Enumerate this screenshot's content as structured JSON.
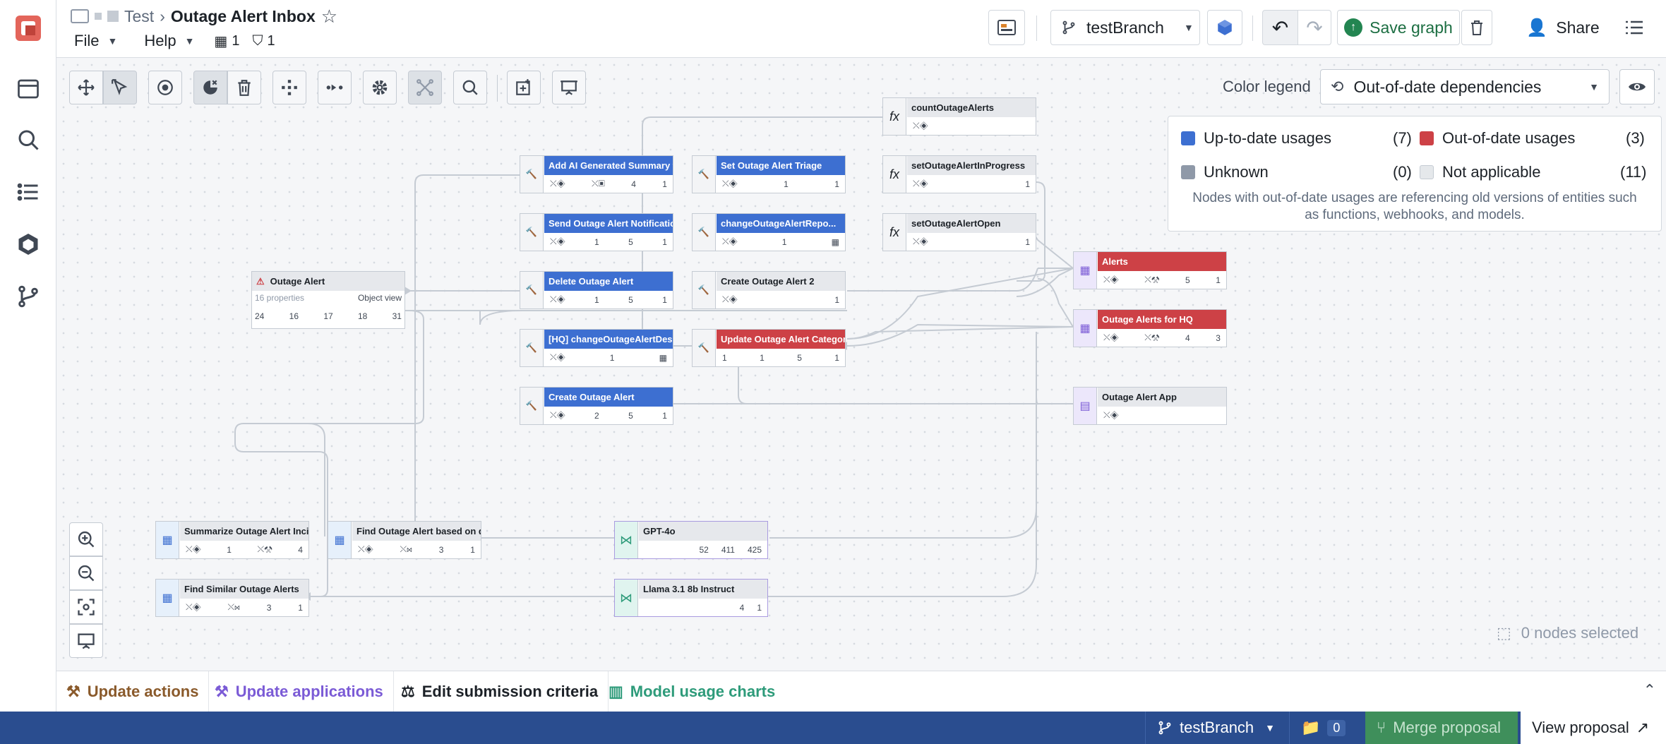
{
  "header": {
    "breadcrumb_parent": "Test",
    "title": "Outage Alert Inbox",
    "menu_file": "File",
    "menu_help": "Help",
    "ontology_count": "1",
    "shield_count": "1",
    "branch": "testBranch",
    "save_label": "Save graph",
    "share_label": "Share"
  },
  "legend": {
    "label": "Color legend",
    "selected": "Out-of-date dependencies",
    "items": [
      {
        "label": "Up-to-date usages",
        "count": "(7)",
        "color": "#3d6fd1"
      },
      {
        "label": "Out-of-date usages",
        "count": "(3)",
        "color": "#cd4146"
      },
      {
        "label": "Unknown",
        "count": "(0)",
        "color": "#8f99a8"
      },
      {
        "label": "Not applicable",
        "count": "(11)",
        "color": "#e5e8eb"
      }
    ],
    "note": "Nodes with out-of-date usages are referencing old versions of entities such as functions, webhooks, and models."
  },
  "nodes": {
    "count_outage_alerts": {
      "title": "countOutageAlerts"
    },
    "add_ai_summary": {
      "title": "Add AI Generated Summary to...",
      "c1": "4",
      "c2": "1"
    },
    "set_triage": {
      "title": "Set Outage Alert Triage",
      "c1": "1",
      "c2": "1"
    },
    "set_in_progress": {
      "title": "setOutageAlertInProgress",
      "c1": "1"
    },
    "send_notification": {
      "title": "Send Outage Alert Notificatio...",
      "c1": "1",
      "c2": "5",
      "c3": "1"
    },
    "change_report": {
      "title": "changeOutageAlertRepo...",
      "c1": "1"
    },
    "set_open": {
      "title": "setOutageAlertOpen",
      "c1": "1"
    },
    "outage_alert": {
      "title": "Outage Alert",
      "props": "16 properties",
      "view": "Object view",
      "c1": "24",
      "c2": "16",
      "c3": "17",
      "c4": "18",
      "c5": "31"
    },
    "delete_alert": {
      "title": "Delete Outage Alert",
      "c1": "1",
      "c2": "5",
      "c3": "1"
    },
    "create_alert_2": {
      "title": "Create Outage Alert 2",
      "c1": "1"
    },
    "alerts": {
      "title": "Alerts",
      "c1": "5",
      "c2": "1"
    },
    "hq_change_desc": {
      "title": "[HQ] changeOutageAlertDescr...",
      "c1": "1"
    },
    "update_category": {
      "title": "Update Outage Alert Category",
      "c1": "1",
      "c2": "1",
      "c3": "5",
      "c4": "1"
    },
    "alerts_hq": {
      "title": "Outage Alerts for HQ",
      "c1": "4",
      "c2": "3"
    },
    "create_alert": {
      "title": "Create Outage Alert",
      "c1": "2",
      "c2": "5",
      "c3": "1"
    },
    "alert_app": {
      "title": "Outage Alert App"
    },
    "summarize": {
      "title": "Summarize Outage Alert Incid...",
      "c1": "1",
      "c2": "4"
    },
    "find_based": {
      "title": "Find Outage Alert based on de...",
      "c1": "3",
      "c2": "1"
    },
    "gpt4o": {
      "title": "GPT-4o",
      "c1": "52",
      "c2": "411",
      "c3": "425"
    },
    "find_similar": {
      "title": "Find Similar Outage Alerts",
      "c1": "3",
      "c2": "1"
    },
    "llama": {
      "title": "Llama 3.1 8b Instruct",
      "c1": "4",
      "c2": "1"
    }
  },
  "selection": {
    "text": "0 nodes selected"
  },
  "bottom_tabs": [
    {
      "label": "Update actions",
      "color": "#8a5a2b"
    },
    {
      "label": "Update applications",
      "color": "#7b5bd6"
    },
    {
      "label": "Edit submission criteria",
      "color": "#1c2127"
    },
    {
      "label": "Model usage charts",
      "color": "#2e9b7a"
    }
  ],
  "statusbar": {
    "branch": "testBranch",
    "proposals": "0",
    "merge": "Merge proposal",
    "view": "View proposal"
  }
}
